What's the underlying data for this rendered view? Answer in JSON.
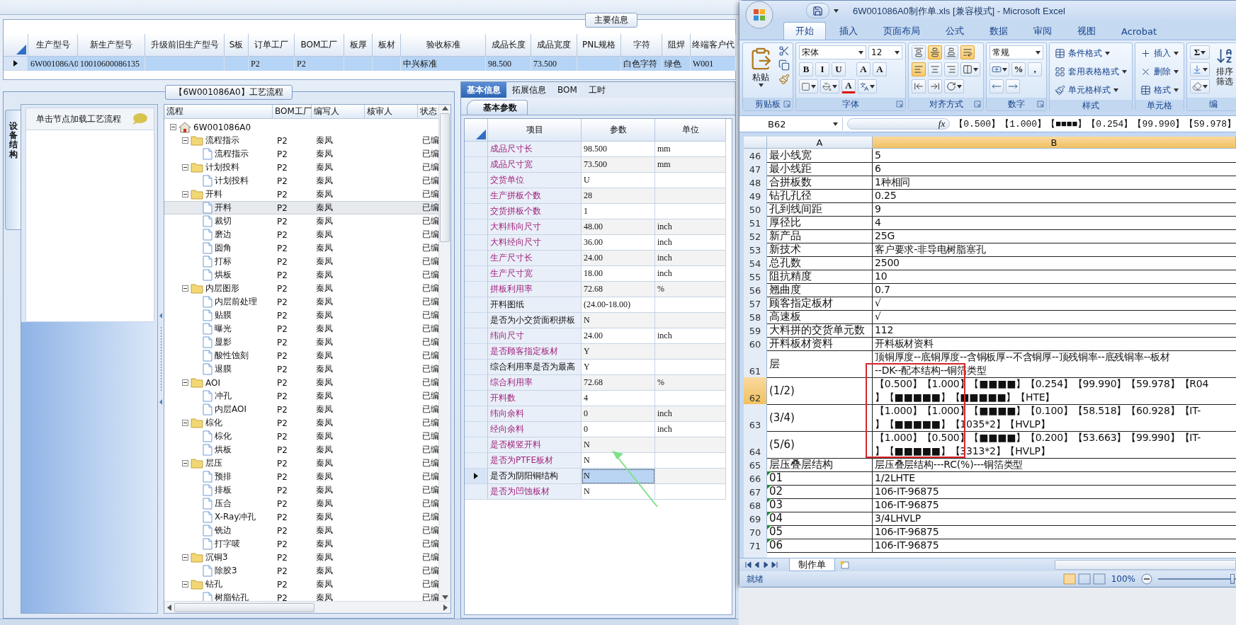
{
  "main_info": {
    "title": "主要信息",
    "columns": [
      "生产型号",
      "新生产型号",
      "升级前旧生产型号",
      "S板",
      "订单工厂",
      "BOM工厂",
      "板厚",
      "板材",
      "验收标准",
      "成品长度",
      "成品宽度",
      "PNL规格",
      "字符",
      "阻焊",
      "终端客户代"
    ],
    "rows": [
      {
        "selected": true,
        "cells": [
          "6W001086A0",
          "10010600086135",
          null,
          null,
          "P2",
          "P2",
          null,
          null,
          "中兴标准",
          "98.500",
          "73.500",
          null,
          "白色字符",
          "绿色",
          "W001"
        ]
      }
    ]
  },
  "process_panel": {
    "title": "【6W001086A0】工艺流程",
    "side_tab": "设备结构",
    "hint": "单击节点加载工艺流程",
    "columns": [
      "流程",
      "BOM工厂",
      "编写人",
      "核审人",
      "状态"
    ],
    "tree": [
      {
        "name": "6W001086A0",
        "kind": "root",
        "expanded": true,
        "selected": false,
        "children": [
          {
            "name": "流程指示",
            "kind": "folder",
            "expanded": true,
            "selected": false,
            "bom": "P2",
            "author": "秦凤",
            "status": "已编",
            "children": [
              {
                "name": "流程指示",
                "kind": "doc",
                "selected": false,
                "bom": "P2",
                "author": "秦凤",
                "status": "已编"
              }
            ]
          },
          {
            "name": "计划投料",
            "kind": "folder",
            "expanded": true,
            "selected": false,
            "bom": "P2",
            "author": "秦凤",
            "status": "已编",
            "children": [
              {
                "name": "计划投料",
                "kind": "doc",
                "selected": false,
                "bom": "P2",
                "author": "秦凤",
                "status": "已编"
              }
            ]
          },
          {
            "name": "开料",
            "kind": "folder",
            "expanded": true,
            "selected": false,
            "bom": "P2",
            "author": "秦凤",
            "status": "已编",
            "children": [
              {
                "name": "开料",
                "kind": "doc",
                "selected": true,
                "bom": "P2",
                "author": "秦凤",
                "status": "已编"
              },
              {
                "name": "裁切",
                "kind": "doc",
                "selected": false,
                "bom": "P2",
                "author": "秦凤",
                "status": "已编"
              },
              {
                "name": "磨边",
                "kind": "doc",
                "selected": false,
                "bom": "P2",
                "author": "秦凤",
                "status": "已编"
              },
              {
                "name": "圆角",
                "kind": "doc",
                "selected": false,
                "bom": "P2",
                "author": "秦凤",
                "status": "已编"
              },
              {
                "name": "打标",
                "kind": "doc",
                "selected": false,
                "bom": "P2",
                "author": "秦凤",
                "status": "已编"
              },
              {
                "name": "烘板",
                "kind": "doc",
                "selected": false,
                "bom": "P2",
                "author": "秦凤",
                "status": "已编"
              }
            ]
          },
          {
            "name": "内层图形",
            "kind": "folder",
            "expanded": true,
            "selected": false,
            "bom": "P2",
            "author": "秦凤",
            "status": "已编",
            "children": [
              {
                "name": "内层前处理",
                "kind": "doc",
                "selected": false,
                "bom": "P2",
                "author": "秦凤",
                "status": "已编"
              },
              {
                "name": "贴膜",
                "kind": "doc",
                "selected": false,
                "bom": "P2",
                "author": "秦凤",
                "status": "已编"
              },
              {
                "name": "曝光",
                "kind": "doc",
                "selected": false,
                "bom": "P2",
                "author": "秦凤",
                "status": "已编"
              },
              {
                "name": "显影",
                "kind": "doc",
                "selected": false,
                "bom": "P2",
                "author": "秦凤",
                "status": "已编"
              },
              {
                "name": "酸性蚀刻",
                "kind": "doc",
                "selected": false,
                "bom": "P2",
                "author": "秦凤",
                "status": "已编"
              },
              {
                "name": "退膜",
                "kind": "doc",
                "selected": false,
                "bom": "P2",
                "author": "秦凤",
                "status": "已编"
              }
            ]
          },
          {
            "name": "AOI",
            "kind": "folder",
            "expanded": true,
            "selected": false,
            "bom": "P2",
            "author": "秦凤",
            "status": "已编",
            "children": [
              {
                "name": "冲孔",
                "kind": "doc",
                "selected": false,
                "bom": "P2",
                "author": "秦凤",
                "status": "已编"
              },
              {
                "name": "内层AOI",
                "kind": "doc",
                "selected": false,
                "bom": "P2",
                "author": "秦凤",
                "status": "已编"
              }
            ]
          },
          {
            "name": "棕化",
            "kind": "folder",
            "expanded": true,
            "selected": false,
            "bom": "P2",
            "author": "秦凤",
            "status": "已编",
            "children": [
              {
                "name": "棕化",
                "kind": "doc",
                "selected": false,
                "bom": "P2",
                "author": "秦凤",
                "status": "已编"
              },
              {
                "name": "烘板",
                "kind": "doc",
                "selected": false,
                "bom": "P2",
                "author": "秦凤",
                "status": "已编"
              }
            ]
          },
          {
            "name": "层压",
            "kind": "folder",
            "expanded": true,
            "selected": false,
            "bom": "P2",
            "author": "秦凤",
            "status": "已编",
            "children": [
              {
                "name": "预排",
                "kind": "doc",
                "selected": false,
                "bom": "P2",
                "author": "秦凤",
                "status": "已编"
              },
              {
                "name": "排板",
                "kind": "doc",
                "selected": false,
                "bom": "P2",
                "author": "秦凤",
                "status": "已编"
              },
              {
                "name": "压合",
                "kind": "doc",
                "selected": false,
                "bom": "P2",
                "author": "秦凤",
                "status": "已编"
              },
              {
                "name": "X-Ray冲孔",
                "kind": "doc",
                "selected": false,
                "bom": "P2",
                "author": "秦凤",
                "status": "已编"
              },
              {
                "name": "铣边",
                "kind": "doc",
                "selected": false,
                "bom": "P2",
                "author": "秦凤",
                "status": "已编"
              },
              {
                "name": "打字唛",
                "kind": "doc",
                "selected": false,
                "bom": "P2",
                "author": "秦凤",
                "status": "已编"
              }
            ]
          },
          {
            "name": "沉铜3",
            "kind": "folder",
            "expanded": true,
            "selected": false,
            "bom": "P2",
            "author": "秦凤",
            "status": "已编",
            "children": [
              {
                "name": "除胶3",
                "kind": "doc",
                "selected": false,
                "bom": "P2",
                "author": "秦凤",
                "status": "已编"
              }
            ]
          },
          {
            "name": "钻孔",
            "kind": "folder",
            "expanded": true,
            "selected": false,
            "bom": "P2",
            "author": "秦凤",
            "status": "已编",
            "children": [
              {
                "name": "树脂钻孔",
                "kind": "doc",
                "selected": false,
                "bom": "P2",
                "author": "秦凤",
                "status": "已编"
              }
            ]
          }
        ]
      }
    ]
  },
  "params_panel": {
    "tabs": [
      {
        "label": "基本信息",
        "selected": true
      },
      {
        "label": "拓展信息",
        "selected": false
      },
      {
        "label": "BOM",
        "selected": false
      },
      {
        "label": "工时",
        "selected": false
      }
    ],
    "sub_tabs": [
      {
        "label": "基本参数",
        "selected": true
      }
    ],
    "columns": [
      "项目",
      "参数",
      "单位"
    ],
    "rows": [
      {
        "item": "成品尺寸长",
        "value": "98.500",
        "unit": "mm",
        "emphasized": true,
        "selected": false
      },
      {
        "item": "成品尺寸宽",
        "value": "73.500",
        "unit": "mm",
        "emphasized": true,
        "selected": false
      },
      {
        "item": "交货单位",
        "value": "U",
        "emphasized": true,
        "selected": false
      },
      {
        "item": "生产拼板个数",
        "value": "28",
        "emphasized": true,
        "selected": false
      },
      {
        "item": "交货拼板个数",
        "value": "1",
        "emphasized": true,
        "selected": false
      },
      {
        "item": "大料纬向尺寸",
        "value": "48.00",
        "unit": "inch",
        "emphasized": true,
        "selected": false
      },
      {
        "item": "大料经向尺寸",
        "value": "36.00",
        "unit": "inch",
        "emphasized": true,
        "selected": false
      },
      {
        "item": "生产尺寸长",
        "value": "24.00",
        "unit": "inch",
        "emphasized": true,
        "selected": false
      },
      {
        "item": "生产尺寸宽",
        "value": "18.00",
        "unit": "inch",
        "emphasized": true,
        "selected": false
      },
      {
        "item": "拼板利用率",
        "value": "72.68",
        "unit": "%",
        "emphasized": true,
        "selected": false
      },
      {
        "item": "开料图纸",
        "value": "(24.00-18.00)",
        "emphasized": false,
        "selected": false
      },
      {
        "item": "是否为小交货面积拼板",
        "value": "N",
        "emphasized": false,
        "selected": false
      },
      {
        "item": "纬向尺寸",
        "value": "24.00",
        "unit": "inch",
        "emphasized": true,
        "selected": false
      },
      {
        "item": "是否顾客指定板材",
        "value": "Y",
        "emphasized": true,
        "selected": false
      },
      {
        "item": "综合利用率是否为最高",
        "value": "Y",
        "emphasized": false,
        "selected": false
      },
      {
        "item": "综合利用率",
        "value": "72.68",
        "unit": "%",
        "emphasized": true,
        "selected": false
      },
      {
        "item": "开料数",
        "value": "4",
        "emphasized": true,
        "selected": false
      },
      {
        "item": "纬向余料",
        "value": "0",
        "unit": "inch",
        "emphasized": true,
        "selected": false
      },
      {
        "item": "经向余料",
        "value": "0",
        "unit": "inch",
        "emphasized": true,
        "selected": false
      },
      {
        "item": "是否横竖开料",
        "value": "N",
        "emphasized": true,
        "selected": false
      },
      {
        "item": "是否为PTFE板材",
        "value": "N",
        "emphasized": true,
        "selected": false
      },
      {
        "item": "是否为阴阳铜结构",
        "value": "N",
        "emphasized": false,
        "selected": true
      },
      {
        "item": "是否为凹蚀板材",
        "value": "N",
        "emphasized": true,
        "selected": false
      }
    ]
  },
  "excel": {
    "title": "6W001086A0制作单.xls  [兼容模式] - Microsoft Excel",
    "ribbon_tabs": [
      {
        "label": "开始",
        "selected": true
      },
      {
        "label": "插入",
        "selected": false
      },
      {
        "label": "页面布局",
        "selected": false
      },
      {
        "label": "公式",
        "selected": false
      },
      {
        "label": "数据",
        "selected": false
      },
      {
        "label": "审阅",
        "selected": false
      },
      {
        "label": "视图",
        "selected": false
      },
      {
        "label": "Acrobat",
        "selected": false
      }
    ],
    "ribbon_groups": [
      {
        "kind": "clipboard",
        "title": "剪贴板",
        "launcher": true,
        "paste": "粘贴"
      },
      {
        "kind": "font",
        "title": "字体",
        "launcher": true,
        "font": "宋体",
        "size": "12",
        "styles": [
          "B",
          "I",
          "U"
        ],
        "grow": [
          "A",
          "A"
        ],
        "color_label": "A"
      },
      {
        "kind": "alignment",
        "title": "对齐方式",
        "launcher": true,
        "vertical": [
          false,
          true,
          false
        ],
        "horizontal": [
          true,
          false,
          false
        ],
        "wrap": true
      },
      {
        "kind": "number",
        "title": "数字",
        "launcher": true,
        "format": "常规",
        "symbols": [
          "%",
          ","
        ]
      },
      {
        "kind": "styles",
        "title": "样式",
        "launcher": false,
        "items": [
          "条件格式",
          "套用表格格式",
          "单元格样式"
        ]
      },
      {
        "kind": "cells",
        "title": "单元格",
        "launcher": false,
        "items": [
          "插入",
          "删除",
          "格式"
        ]
      },
      {
        "kind": "editing",
        "title": "编",
        "launcher": false,
        "sum": "Σ",
        "sort": [
          "排序",
          "筛选"
        ]
      }
    ],
    "name_box": "B62",
    "fx_label": "fx",
    "formula": "【0.500】【1.000】【■■■■】【0.254】【99.990】【59.978】",
    "columns": [
      {
        "label": "A",
        "selected": false
      },
      {
        "label": "B",
        "selected": true
      }
    ],
    "rows": [
      {
        "num": "46",
        "a": "最小线宽",
        "b": [
          "5"
        ],
        "selected": false,
        "flag": false
      },
      {
        "num": "47",
        "a": "最小线距",
        "b": [
          "6"
        ],
        "selected": false,
        "flag": false
      },
      {
        "num": "48",
        "a": "合拼板数",
        "b": [
          "1种相同"
        ],
        "selected": false,
        "flag": false
      },
      {
        "num": "49",
        "a": "钻孔孔径",
        "b": [
          "0.25"
        ],
        "selected": false,
        "flag": false
      },
      {
        "num": "50",
        "a": "孔到线间距",
        "b": [
          "9"
        ],
        "selected": false,
        "flag": false
      },
      {
        "num": "51",
        "a": "厚径比",
        "b": [
          "4"
        ],
        "selected": false,
        "flag": false
      },
      {
        "num": "52",
        "a": "新产品",
        "b": [
          "25G"
        ],
        "selected": false,
        "flag": false
      },
      {
        "num": "53",
        "a": "新技术",
        "b": [
          "客户要求-非导电树脂塞孔"
        ],
        "selected": false,
        "flag": false
      },
      {
        "num": "54",
        "a": "总孔数",
        "b": [
          "2500"
        ],
        "selected": false,
        "flag": false
      },
      {
        "num": "55",
        "a": "阻抗精度",
        "b": [
          "10"
        ],
        "selected": false,
        "flag": false
      },
      {
        "num": "56",
        "a": "翘曲度",
        "b": [
          "0.7"
        ],
        "selected": false,
        "flag": false
      },
      {
        "num": "57",
        "a": "顾客指定板材",
        "b": [
          "√"
        ],
        "selected": false,
        "flag": false
      },
      {
        "num": "58",
        "a": "高速板",
        "b": [
          "√"
        ],
        "selected": false,
        "flag": false
      },
      {
        "num": "59",
        "a": "大料拼的交货单元数",
        "b": [
          "112"
        ],
        "selected": false,
        "flag": false
      },
      {
        "num": "60",
        "a": "开料板材资料",
        "b": [
          "开料板材资料"
        ],
        "selected": false,
        "flag": false
      },
      {
        "num": "61",
        "a": "层",
        "b": [
          "顶铜厚度--底铜厚度--含铜板厚--不含铜厚--顶残铜率--底残铜率--板材",
          "--DK--配本结构--铜箔类型"
        ],
        "selected": false,
        "flag": false
      },
      {
        "num": "62",
        "a": "(1/2)",
        "b": [
          "【0.500】【1.000】【■■■■】【0.254】【99.990】【59.978】【R04",
          "】【■■■■■】【■■■■■】【HTE】"
        ],
        "selected": true,
        "flag": false
      },
      {
        "num": "63",
        "a": "(3/4)",
        "b": [
          "【1.000】【1.000】【■■■■】【0.100】【58.518】【60.928】【IT-",
          "】【■■■■■】【1035*2】【HVLP】"
        ],
        "selected": false,
        "flag": false
      },
      {
        "num": "64",
        "a": "(5/6)",
        "b": [
          "【1.000】【0.500】【■■■■】【0.200】【53.663】【99.990】【IT-",
          "】【■■■■■】【3313*2】【HVLP】"
        ],
        "selected": false,
        "flag": false
      },
      {
        "num": "65",
        "a": "层压叠层结构",
        "b": [
          "层压叠层结构---RC(%)---铜箔类型"
        ],
        "selected": false,
        "flag": false
      },
      {
        "num": "66",
        "a": "01",
        "b": [
          "1/2LHTE"
        ],
        "selected": false,
        "flag": true
      },
      {
        "num": "67",
        "a": "02",
        "b": [
          "106-IT-96875"
        ],
        "selected": false,
        "flag": true
      },
      {
        "num": "68",
        "a": "03",
        "b": [
          "106-IT-96875"
        ],
        "selected": false,
        "flag": true
      },
      {
        "num": "69",
        "a": "04",
        "b": [
          "3/4LHVLP"
        ],
        "selected": false,
        "flag": true
      },
      {
        "num": "70",
        "a": "05",
        "b": [
          "106-IT-96875"
        ],
        "selected": false,
        "flag": true
      },
      {
        "num": "71",
        "a": "06",
        "b": [
          "106-IT-96875"
        ],
        "selected": false,
        "flag": true
      }
    ],
    "sheet_tabs": [
      {
        "label": "制作单",
        "selected": true
      }
    ],
    "status": "就绪",
    "zoom": "100%",
    "zoom_slider": {
      "level": 0.95
    }
  }
}
